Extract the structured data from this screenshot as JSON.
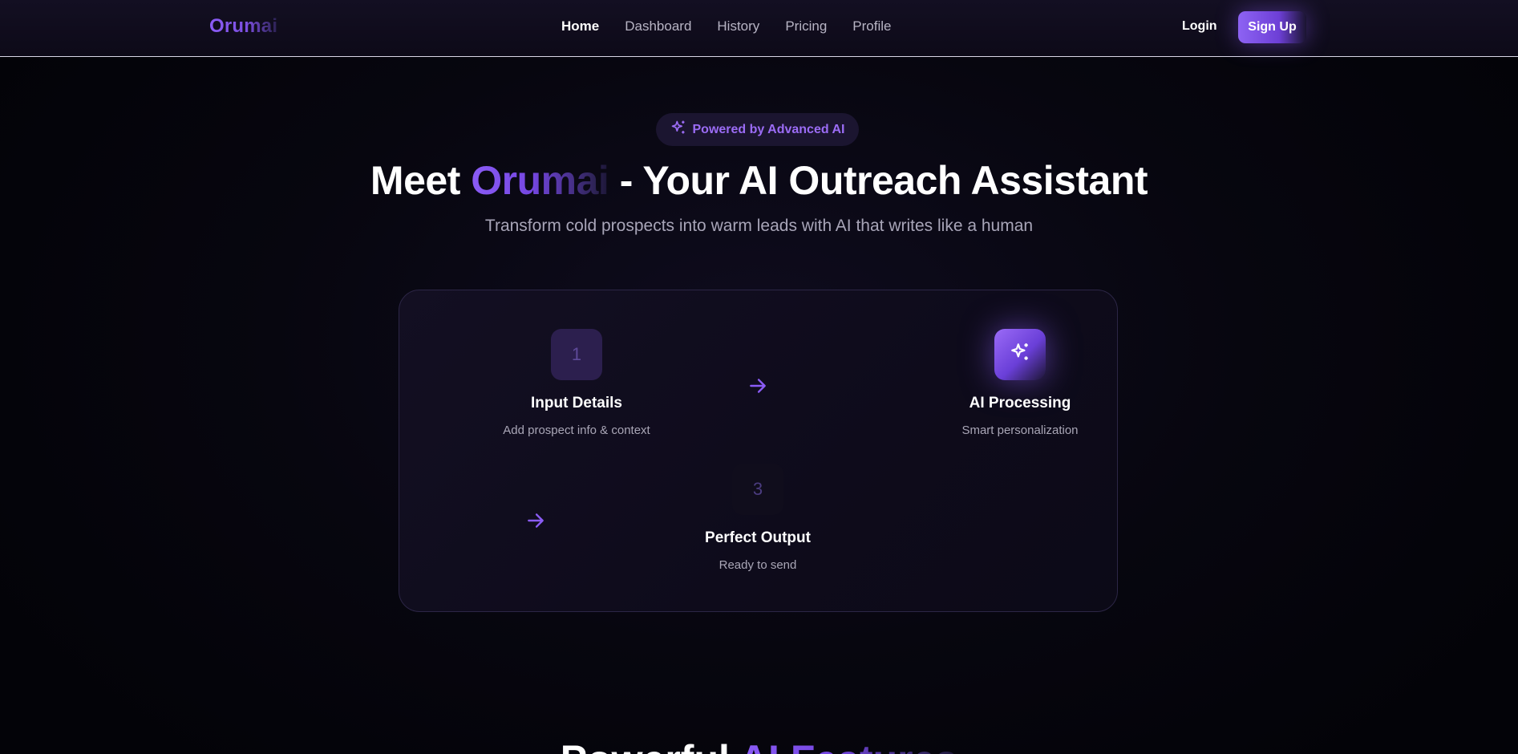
{
  "nav": {
    "logo": "Orumai",
    "links": [
      {
        "label": "Home",
        "active": true
      },
      {
        "label": "Dashboard",
        "active": false
      },
      {
        "label": "History",
        "active": false
      },
      {
        "label": "Pricing",
        "active": false
      },
      {
        "label": "Profile",
        "active": false
      }
    ],
    "login_label": "Login",
    "signup_label": "Sign Up"
  },
  "hero": {
    "badge_icon": "sparkles-icon",
    "badge_text": "Powered by Advanced AI",
    "title_prefix": "Meet ",
    "title_brand": "Orumai",
    "title_suffix": " - Your AI Outreach Assistant",
    "subtitle": "Transform cold prospects into warm leads with AI that writes like a human"
  },
  "steps": [
    {
      "number": "1",
      "title": "Input Details",
      "description": "Add prospect info & context"
    },
    {
      "icon": "sparkles-icon",
      "title": "AI Processing",
      "description": "Smart personalization"
    },
    {
      "number": "3",
      "title": "Perfect Output",
      "description": "Ready to send"
    }
  ],
  "features_section": {
    "title_prefix": "Powerful ",
    "title_highlight": "AI Features"
  },
  "colors": {
    "accent": "#8b5cf6",
    "background": "#05040b",
    "nav_background": "#110d1f",
    "card_background": "#110e1f"
  }
}
